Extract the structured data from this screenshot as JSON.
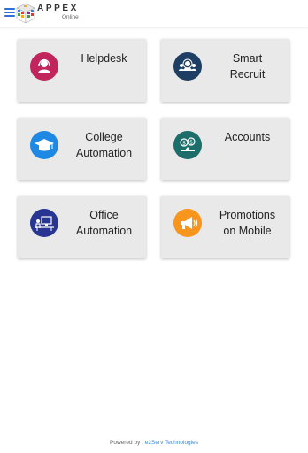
{
  "header": {
    "brand": "APPEX",
    "brand_sub": "Online",
    "menu_icon": "hamburger-icon"
  },
  "tiles": [
    {
      "label": "Helpdesk",
      "icon": "helpdesk-agent-icon",
      "color": "#c2255c"
    },
    {
      "label": "Smart\nRecruit",
      "icon": "recruit-icon",
      "color": "#1f3e63"
    },
    {
      "label": "College\nAutomation",
      "icon": "graduation-cap-icon",
      "color": "#1e88e5"
    },
    {
      "label": "Accounts",
      "icon": "accounts-icon",
      "color": "#1d6d6a"
    },
    {
      "label": "Office\nAutomation",
      "icon": "office-desk-icon",
      "color": "#283593"
    },
    {
      "label": "Promotions\non Mobile",
      "icon": "megaphone-icon",
      "color": "#f7951d"
    }
  ],
  "footer": {
    "prefix": "Powered by : ",
    "company": "e2Serv Technologies"
  }
}
